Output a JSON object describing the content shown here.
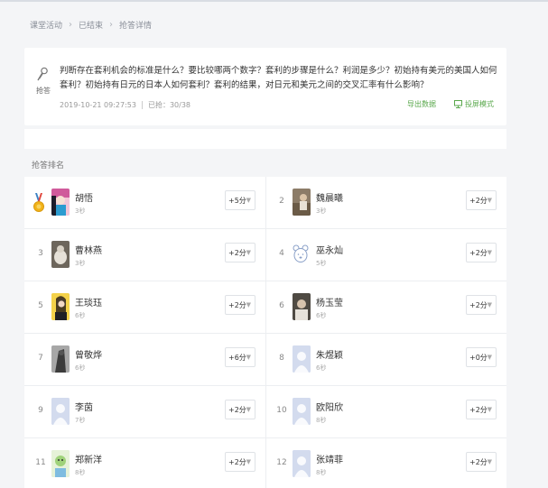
{
  "breadcrumb": [
    {
      "label": "课堂活动"
    },
    {
      "label": "已结束"
    },
    {
      "label": "抢答详情"
    }
  ],
  "question": {
    "icon_label": "抢答",
    "text": "判断存在套利机会的标准是什么？要比较哪两个数字？套利的步骤是什么？利润是多少？初始持有美元的美国人如何套利？初始持有日元的日本人如何套利？套利的结果，对日元和美元之间的交叉汇率有什么影响？",
    "datetime": "2019-10-21 09:27:53",
    "answered": "已抢：30/38",
    "export_label": "导出数据",
    "screen_label": "投屏模式"
  },
  "ranking_title": "抢答排名",
  "entries": [
    {
      "rank": "1",
      "name": "胡悟",
      "sub": "3秒",
      "score": "+5分",
      "avatar": "photo-pink"
    },
    {
      "rank": "2",
      "name": "魏晨曦",
      "sub": "3秒",
      "score": "+2分",
      "avatar": "photo-brown"
    },
    {
      "rank": "3",
      "name": "曹林燕",
      "sub": "3秒",
      "score": "+2分",
      "avatar": "photo-cat"
    },
    {
      "rank": "4",
      "name": "巫永灿",
      "sub": "5秒",
      "score": "+2分",
      "avatar": "bear-icon"
    },
    {
      "rank": "5",
      "name": "王琰珏",
      "sub": "6秒",
      "score": "+2分",
      "avatar": "photo-yellow"
    },
    {
      "rank": "6",
      "name": "杨玉莹",
      "sub": "6秒",
      "score": "+2分",
      "avatar": "photo-dark"
    },
    {
      "rank": "7",
      "name": "曾敬烨",
      "sub": "6秒",
      "score": "+6分",
      "avatar": "photo-gray"
    },
    {
      "rank": "8",
      "name": "朱煜颖",
      "sub": "6秒",
      "score": "+0分",
      "avatar": "default"
    },
    {
      "rank": "9",
      "name": "李茵",
      "sub": "7秒",
      "score": "+2分",
      "avatar": "default"
    },
    {
      "rank": "10",
      "name": "欧阳欣",
      "sub": "8秒",
      "score": "+2分",
      "avatar": "default"
    },
    {
      "rank": "11",
      "name": "郑新洋",
      "sub": "8秒",
      "score": "+2分",
      "avatar": "photo-green"
    },
    {
      "rank": "12",
      "name": "张靖菲",
      "sub": "8秒",
      "score": "+2分",
      "avatar": "default"
    }
  ],
  "colors": {
    "accent": "#5aa84c",
    "background": "#f4f5f7"
  }
}
